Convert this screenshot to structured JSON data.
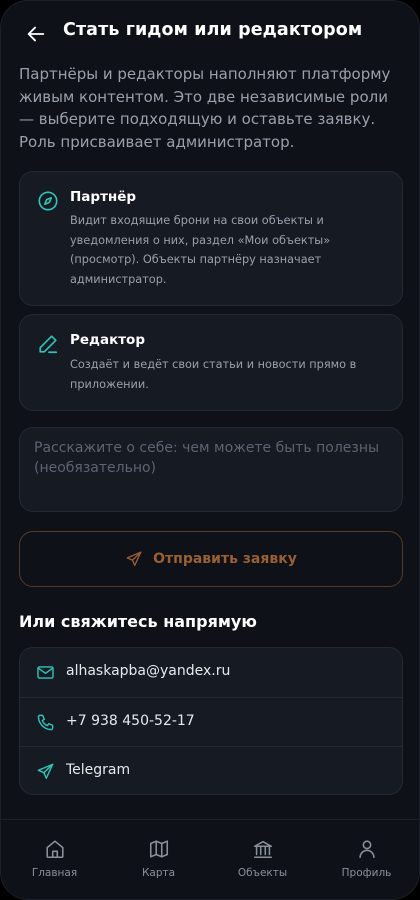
{
  "header": {
    "title": "Стать гидом или редактором",
    "back_icon": "arrow-left-icon"
  },
  "intro": "Партнёры и редакторы наполняют платформу живым контентом. Это две независимые роли — выберите подходящую и оставьте заявку. Роль присваивает администратор.",
  "roles": [
    {
      "icon": "compass-icon",
      "title": "Партнёр",
      "description": "Видит входящие брони на свои объекты и уведомления о них, раздел «Мои объекты» (просмотр). Объекты партнёру назначает администратор."
    },
    {
      "icon": "pen-icon",
      "title": "Редактор",
      "description": "Создаёт и ведёт свои статьи и новости прямо в приложении."
    }
  ],
  "about": {
    "value": "",
    "placeholder": "Расскажите о себе: чем можете быть полезны (необязательно)"
  },
  "submit": {
    "label": "Отправить заявку",
    "icon": "send-icon"
  },
  "contacts": {
    "title": "Или свяжитесь напрямую",
    "items": [
      {
        "icon": "mail-icon",
        "label": "alhaskapba@yandex.ru"
      },
      {
        "icon": "phone-icon",
        "label": "+7 938 450-52-17"
      },
      {
        "icon": "send-icon",
        "label": "Telegram"
      }
    ]
  },
  "tabs": [
    {
      "icon": "home-icon",
      "label": "Главная"
    },
    {
      "icon": "map-icon",
      "label": "Карта"
    },
    {
      "icon": "landmark-icon",
      "label": "Объекты"
    },
    {
      "icon": "user-icon",
      "label": "Профиль"
    }
  ],
  "colors": {
    "background": "#0e1118",
    "card": "#161a23",
    "accent_teal": "#2ec4b6",
    "accent_orange": "#9a5f33",
    "text_muted": "#9aa0ab"
  }
}
